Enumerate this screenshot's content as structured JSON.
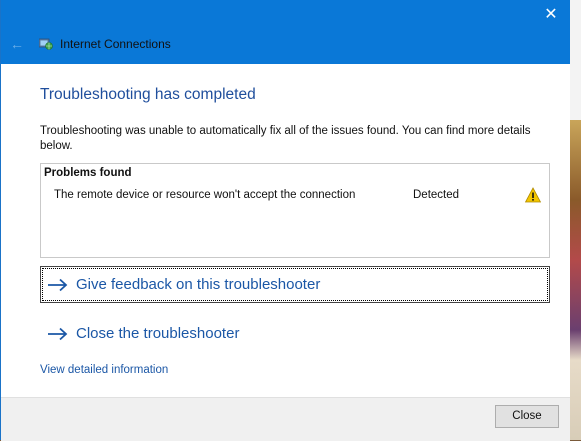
{
  "window": {
    "title": "Internet Connections",
    "close_glyph": "✕",
    "back_glyph": "←"
  },
  "main": {
    "heading": "Troubleshooting has completed",
    "summary": "Troubleshooting was unable to automatically fix all of the issues found. You can find more details below."
  },
  "problems": {
    "title": "Problems found",
    "items": [
      {
        "text": "The remote device or resource won't accept the connection",
        "status": "Detected",
        "icon": "warning-icon"
      }
    ]
  },
  "links": {
    "feedback": "Give feedback on this troubleshooter",
    "close_troubleshooter": "Close the troubleshooter",
    "view_details": "View detailed information"
  },
  "footer": {
    "close_label": "Close"
  },
  "colors": {
    "titlebar": "#0a78d7",
    "heading": "#1f4e9c",
    "link": "#1b57a6",
    "warning": "#f2c500"
  }
}
